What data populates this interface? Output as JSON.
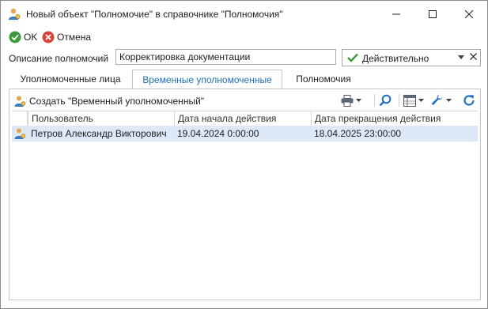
{
  "window": {
    "title": "Новый объект \"Полномочие\" в справочнике \"Полномочия\""
  },
  "toolbar": {
    "ok_label": "OK",
    "cancel_label": "Отмена"
  },
  "form": {
    "description_label": "Описание полномочий",
    "description_value": "Корректировка документации",
    "status_value": "Действительно"
  },
  "tabs": [
    {
      "label": "Уполномоченные лица"
    },
    {
      "label": "Временные уполномоченные",
      "active": true
    },
    {
      "label": "Полномочия"
    }
  ],
  "panel": {
    "create_label": "Создать \"Временный уполномоченный\"",
    "columns": [
      "Пользователь",
      "Дата начала действия",
      "Дата прекращения действия"
    ],
    "rows": [
      {
        "user": "Петров Александр Викторович",
        "start": "19.04.2024 0:00:00",
        "end": "18.04.2025 23:00:00"
      }
    ]
  },
  "colors": {
    "accent": "#1f6fbf",
    "ok_green": "#3c9a3c",
    "cancel_red": "#d9443a",
    "selected_row": "#dde9f7"
  }
}
